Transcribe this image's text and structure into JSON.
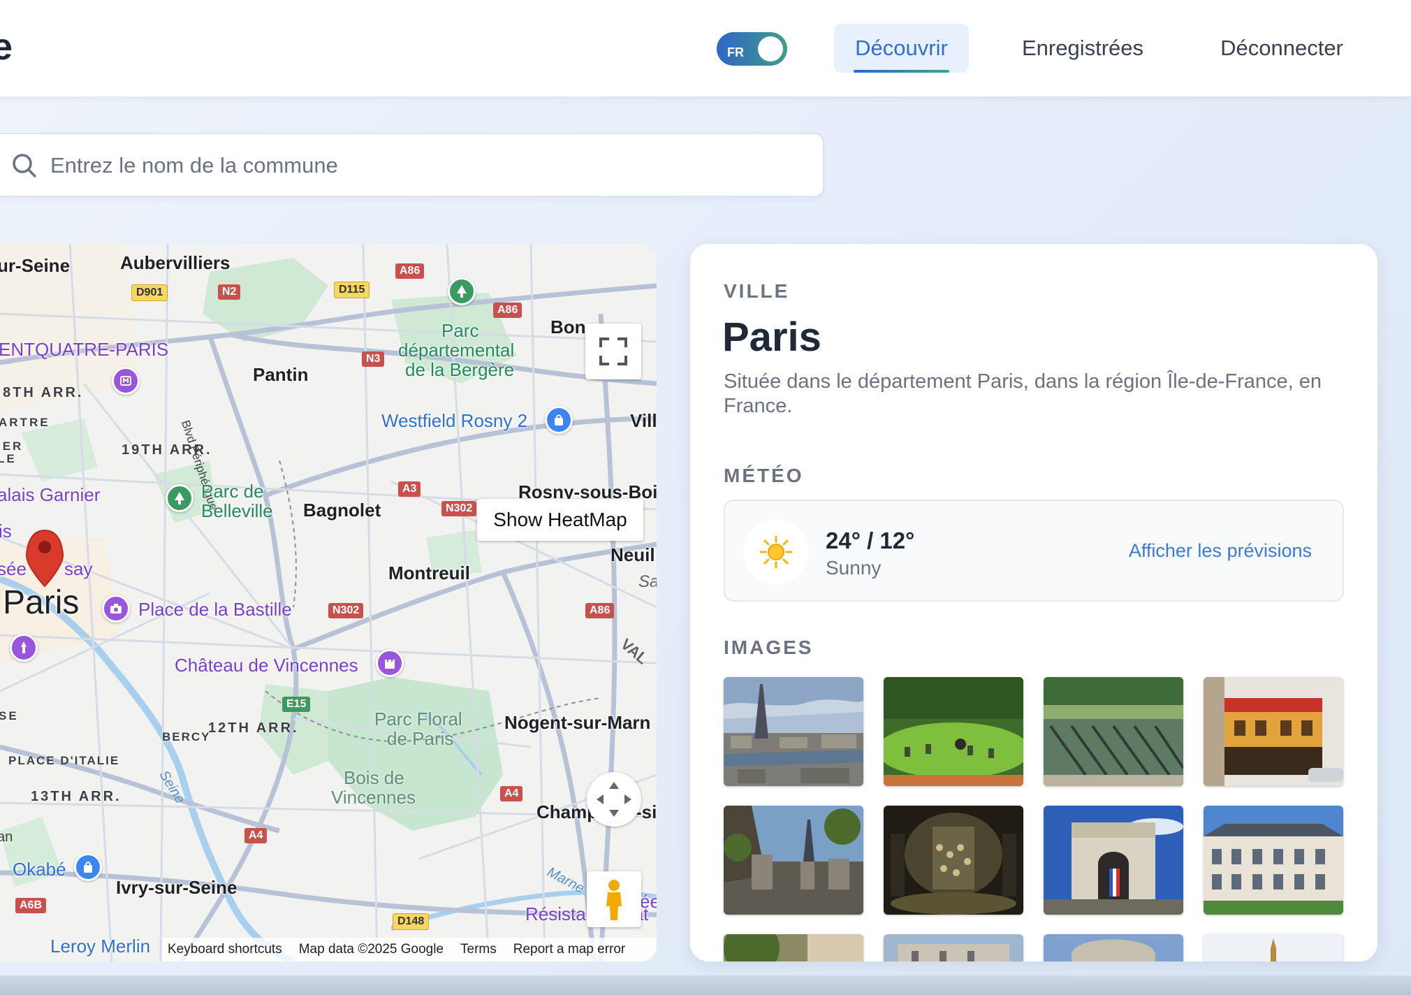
{
  "header": {
    "brand_fragment": "e",
    "lang_toggle": "FR",
    "nav": {
      "discover": "Découvrir",
      "saved": "Enregistrées",
      "logout": "Déconnecter"
    }
  },
  "search": {
    "placeholder": "Entrez le nom de la commune",
    "value": ""
  },
  "map": {
    "heatmap_button": "Show HeatMap",
    "footer": {
      "keyboard": "Keyboard shortcuts",
      "data": "Map data ©2025 Google",
      "terms": "Terms",
      "report": "Report a map error"
    },
    "labels": {
      "aubervilliers": "Aubervilliers",
      "sur_seine": "ur-Seine",
      "centquatre": "ENTQUATRE-PARIS",
      "arr18": "8TH ARR.",
      "artre": "ARTRE",
      "ier": "IER",
      "le": "LE",
      "arr19": "19TH ARR.",
      "pantin": "Pantin",
      "blvd": "Blvd Périphérique",
      "parc_bergere_1": "Parc",
      "parc_bergere_2": "départemental",
      "parc_bergere_3": "de la Bergère",
      "bondy": "Bon",
      "westfield": "Westfield Rosny 2",
      "vill": "Vill",
      "palais_garnier": "alais Garnier",
      "is": "is",
      "parc_belleville_1": "Parc de",
      "parc_belleville_2": "Belleville",
      "bagnolet": "Bagnolet",
      "rosny": "Rosny-sous-Boi",
      "orsay_a": "sée",
      "orsay_b": "say",
      "paris": "Paris",
      "neuil": "Neuil",
      "montreuil": "Montreuil",
      "bastille": "Place de la Bastille",
      "vincennes": "Château de Vincennes",
      "se": "SE",
      "bercy": "BERCY",
      "arr12": "12TH ARR.",
      "parc_floral_1": "Parc Floral",
      "parc_floral_2": "de Paris",
      "nogent": "Nogent-sur-Marn",
      "place_italie": "PLACE D'ITALIE",
      "seine": "Seine",
      "arr13": "13TH ARR.",
      "bois_1": "Bois de",
      "bois_2": "Vincennes",
      "champ": "Champ",
      "si": "-si",
      "an": "an",
      "okabe": "Okabé",
      "ivry": "Ivry-sur-Seine",
      "marne": "Marne",
      "resistance": "Résistance Nat",
      "ee": "ée",
      "leroy": "Leroy Merlin",
      "sa": "Sa",
      "val": "VAL"
    },
    "shields": {
      "d901": "D901",
      "n2": "N2",
      "d115": "D115",
      "a86a": "A86",
      "a86b": "A86",
      "n3": "N3",
      "a3": "A3",
      "n302a": "N302",
      "n302b": "N302",
      "a86c": "A86",
      "e15": "E15",
      "a4a": "A4",
      "a4b": "A4",
      "a6b": "A6B",
      "d148": "D148"
    }
  },
  "city": {
    "section_label": "VILLE",
    "name": "Paris",
    "description": "Située dans le département Paris, dans la région Île-de-France, en France."
  },
  "weather": {
    "section_label": "MÉTÉO",
    "icon": "sun-icon",
    "temperature": "24° / 12°",
    "condition": "Sunny",
    "forecast_link": "Afficher les prévisions"
  },
  "images": {
    "section_label": "IMAGES",
    "items": [
      "eiffel-tower-panorama",
      "park-lawn-chairs",
      "garden-chairs-row",
      "bataclan-facade",
      "cemetery-tombs",
      "catacombs-pillar",
      "arc-de-triomphe",
      "palace-facade",
      "partial-tree",
      "partial-building",
      "partial-monument",
      "partial-spire"
    ]
  },
  "colors": {
    "accent": "#2f6fd0",
    "toggle_gradient_start": "#2f66c8",
    "toggle_gradient_end": "#3f9c8a",
    "map_pin": "#d93a2b"
  }
}
